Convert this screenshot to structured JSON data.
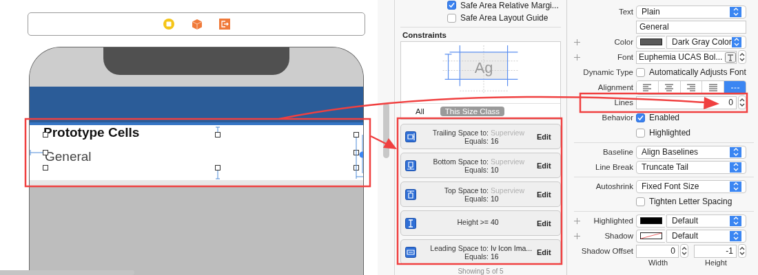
{
  "canvas": {
    "section_title": "Prototype Cells",
    "cell_label": "General"
  },
  "constraints_panel": {
    "options": [
      {
        "label": "Safe Area Relative Margi...",
        "checked": true
      },
      {
        "label": "Safe Area Layout Guide",
        "checked": false
      }
    ],
    "title": "Constraints",
    "diagram_sample": "Ag",
    "tabs": [
      {
        "label": "All",
        "selected": false
      },
      {
        "label": "This Size Class",
        "selected": true
      }
    ],
    "items": [
      {
        "kind": "trailing",
        "lines": [
          {
            "label": "Trailing Space to:",
            "value": "Superview",
            "dimmed": true
          },
          {
            "label": "Equals:",
            "value": "16",
            "dimmed": false
          }
        ],
        "action": "Edit"
      },
      {
        "kind": "bottom",
        "lines": [
          {
            "label": "Bottom Space to:",
            "value": "Superview",
            "dimmed": true
          },
          {
            "label": "Equals:",
            "value": "10",
            "dimmed": false
          }
        ],
        "action": "Edit"
      },
      {
        "kind": "top",
        "lines": [
          {
            "label": "Top Space to:",
            "value": "Superview",
            "dimmed": true
          },
          {
            "label": "Equals:",
            "value": "10",
            "dimmed": false
          }
        ],
        "action": "Edit"
      },
      {
        "kind": "height",
        "lines": [
          {
            "label": "Height >=",
            "value": "40",
            "dimmed": false
          }
        ],
        "action": "Edit"
      },
      {
        "kind": "leading",
        "lines": [
          {
            "label": "Leading Space to:",
            "value": "Iv Icon Ima...",
            "dimmed": false
          },
          {
            "label": "Equals:",
            "value": "16",
            "dimmed": false
          }
        ],
        "action": "Edit"
      }
    ],
    "footer": "Showing 5 of 5"
  },
  "attributes": {
    "rows": [
      {
        "kind": "popup",
        "label": "Text",
        "value": "Plain",
        "plus": false,
        "divider_before": false
      },
      {
        "kind": "field",
        "value": "General",
        "plus": false,
        "divider_before": false
      },
      {
        "kind": "color",
        "label": "Color",
        "color": "#5a5a5a",
        "value": "Dark Gray Color",
        "plus": true,
        "divider_before": false
      },
      {
        "kind": "font",
        "label": "Font",
        "value": "Euphemia UCAS Bol...",
        "plus": true,
        "divider_before": false
      },
      {
        "kind": "checkbox",
        "label": "Dynamic Type",
        "text": "Automatically Adjusts Font",
        "checked": false,
        "plus": false,
        "divider_before": false
      },
      {
        "kind": "alignment",
        "label": "Alignment",
        "options": [
          {
            "kind": "left",
            "selected": false
          },
          {
            "kind": "center",
            "selected": false
          },
          {
            "kind": "right",
            "selected": false
          },
          {
            "kind": "justified",
            "selected": false
          },
          {
            "kind": "natural",
            "selected": true
          }
        ],
        "plus": false,
        "divider_before": false
      },
      {
        "kind": "stepper",
        "label": "Lines",
        "value": "0",
        "plus": false,
        "divider_before": false
      },
      {
        "kind": "checkbox",
        "label": "Behavior",
        "text": "Enabled",
        "checked": true,
        "plus": false,
        "divider_before": false
      },
      {
        "kind": "checkbox",
        "text": "Highlighted",
        "checked": false,
        "plus": false,
        "divider_before": false
      },
      {
        "kind": "popup",
        "label": "Baseline",
        "value": "Align Baselines",
        "plus": false,
        "divider_before": true
      },
      {
        "kind": "popup",
        "label": "Line Break",
        "value": "Truncate Tail",
        "plus": false,
        "divider_before": false
      },
      {
        "kind": "popup",
        "label": "Autoshrink",
        "value": "Fixed Font Size",
        "plus": false,
        "divider_before": true
      },
      {
        "kind": "checkbox",
        "text": "Tighten Letter Spacing",
        "checked": false,
        "plus": false,
        "divider_before": false
      },
      {
        "kind": "color",
        "label": "Highlighted",
        "color": "#000000",
        "value": "Default",
        "plus": true,
        "divider_before": true
      },
      {
        "kind": "color",
        "label": "Shadow",
        "value": "Default",
        "plus": true,
        "divider_before": false
      },
      {
        "kind": "offset",
        "label": "Shadow Offset",
        "fields": [
          {
            "value": "0",
            "caption": "Width"
          },
          {
            "value": "-1",
            "caption": "Height"
          }
        ],
        "plus": false,
        "divider_before": false
      }
    ]
  }
}
